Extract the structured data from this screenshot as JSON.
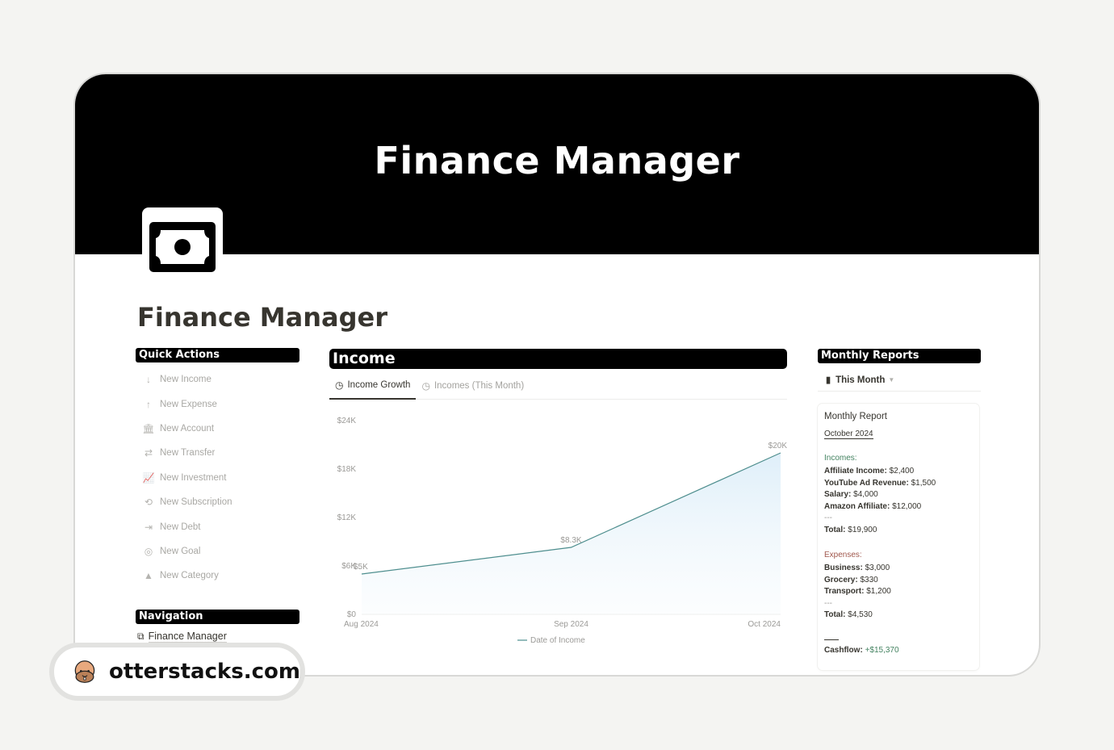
{
  "cover": {
    "title": "Finance Manager"
  },
  "page": {
    "icon": "banknote-icon",
    "title": "Finance Manager"
  },
  "quick_actions": {
    "header": "Quick Actions",
    "items": [
      {
        "label": "New Income",
        "icon": "arrow-down-icon"
      },
      {
        "label": "New Expense",
        "icon": "arrow-up-icon"
      },
      {
        "label": "New Account",
        "icon": "bank-icon"
      },
      {
        "label": "New Transfer",
        "icon": "transfer-icon"
      },
      {
        "label": "New Investment",
        "icon": "chart-icon"
      },
      {
        "label": "New Subscription",
        "icon": "repeat-icon"
      },
      {
        "label": "New Debt",
        "icon": "exit-icon"
      },
      {
        "label": "New Goal",
        "icon": "target-icon"
      },
      {
        "label": "New Category",
        "icon": "shapes-icon"
      }
    ]
  },
  "navigation": {
    "header": "Navigation",
    "items": [
      {
        "label": "Finance Manager",
        "icon": "page-link-icon"
      }
    ]
  },
  "income": {
    "header": "Income",
    "tabs": [
      {
        "label": "Income Growth",
        "active": true
      },
      {
        "label": "Incomes (This Month)",
        "active": false
      }
    ]
  },
  "chart_data": {
    "type": "area",
    "title": "",
    "categories": [
      "Aug 2024",
      "Sep 2024",
      "Oct 2024"
    ],
    "series": [
      {
        "name": "Date of Income",
        "values": [
          5000,
          8300,
          20000
        ],
        "data_labels": [
          "$5K",
          "$8.3K",
          "$20K"
        ]
      }
    ],
    "yticks": [
      0,
      6000,
      12000,
      18000,
      24000
    ],
    "ytick_labels": [
      "$0",
      "$6K",
      "$12K",
      "$18K",
      "$24K"
    ],
    "ylim": [
      0,
      24000
    ],
    "xlabel": "",
    "ylabel": "",
    "legend": "bottom-center",
    "grid": false,
    "line_color": "#4e8e8e"
  },
  "monthly_reports": {
    "header": "Monthly Reports",
    "view": "This Month",
    "card": {
      "title": "Monthly Report",
      "month": "October 2024",
      "incomes_label": "Incomes:",
      "incomes": [
        {
          "name": "Affiliate Income",
          "value": "$2,400"
        },
        {
          "name": "YouTube Ad Revenue",
          "value": "$1,500"
        },
        {
          "name": "Salary",
          "value": "$4,000"
        },
        {
          "name": "Amazon Affiliate",
          "value": "$12,000"
        }
      ],
      "separator": "---",
      "incomes_total_label": "Total:",
      "incomes_total": "$19,900",
      "expenses_label": "Expenses:",
      "expenses": [
        {
          "name": "Business",
          "value": "$3,000"
        },
        {
          "name": "Grocery",
          "value": "$330"
        },
        {
          "name": "Transport",
          "value": "$1,200"
        }
      ],
      "expenses_total_label": "Total:",
      "expenses_total": "$4,530",
      "cashflow_label": "Cashflow:",
      "cashflow": "+$15,370"
    }
  },
  "watermark": {
    "site": "otterstacks.com",
    "icon": "otter-icon"
  }
}
